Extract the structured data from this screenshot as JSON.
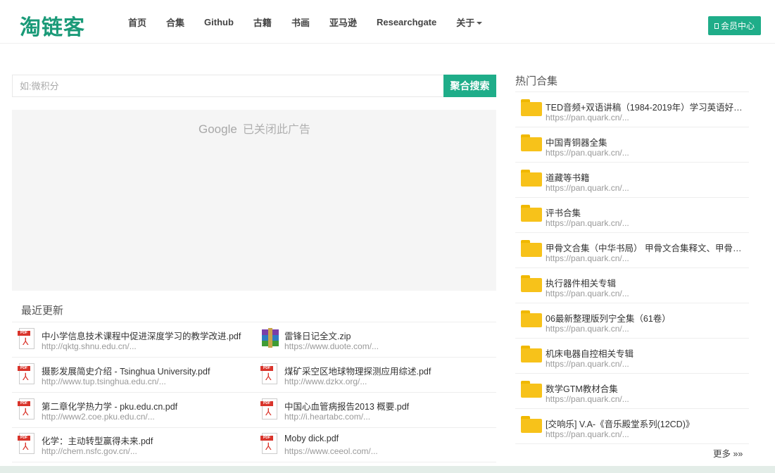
{
  "header": {
    "logo": "淘链客",
    "nav": [
      {
        "label": "首页"
      },
      {
        "label": "合集"
      },
      {
        "label": "Github"
      },
      {
        "label": "古籍"
      },
      {
        "label": "书画"
      },
      {
        "label": "亚马逊"
      },
      {
        "label": "Researchgate"
      },
      {
        "label": "关于"
      }
    ],
    "member_button": "会员中心"
  },
  "search": {
    "placeholder": "如:微积分",
    "button": "聚合搜索"
  },
  "ad": {
    "brand": "Google",
    "text": "已关闭此广告"
  },
  "recent": {
    "title": "最近更新",
    "items": [
      {
        "name": "中小学信息技术课程中促进深度学习的教学改进.pdf",
        "url": "http://qktg.shnu.edu.cn/...",
        "icon": "pdf-icon"
      },
      {
        "name": "雷锋日记全文.zip",
        "url": "https://www.duote.com/...",
        "icon": "zip-icon"
      },
      {
        "name": "摄影发展简史介绍 - Tsinghua University.pdf",
        "url": "http://www.tup.tsinghua.edu.cn/...",
        "icon": "pdf-icon"
      },
      {
        "name": "煤矿采空区地球物理探测应用综述.pdf",
        "url": "http://www.dzkx.org/...",
        "icon": "pdf-icon"
      },
      {
        "name": "第二章化学热力学 - pku.edu.cn.pdf",
        "url": "http://www2.coe.pku.edu.cn/...",
        "icon": "pdf-icon"
      },
      {
        "name": "中国心血管病报告2013 概要.pdf",
        "url": "http://i.heartabc.com/...",
        "icon": "pdf-icon"
      },
      {
        "name": "化学：主动转型赢得未来.pdf",
        "url": "http://chem.nsfc.gov.cn/...",
        "icon": "pdf-icon"
      },
      {
        "name": "Moby dick.pdf",
        "url": "https://www.ceeol.com/...",
        "icon": "pdf-icon"
      }
    ]
  },
  "hot": {
    "title": "热门合集",
    "items": [
      {
        "name": "TED音频+双语讲稿（1984-2019年）学习英语好资...",
        "url": "https://pan.quark.cn/..."
      },
      {
        "name": "中国青铜器全集",
        "url": "https://pan.quark.cn/..."
      },
      {
        "name": "道藏等书籍",
        "url": "https://pan.quark.cn/..."
      },
      {
        "name": "评书合集",
        "url": "https://pan.quark.cn/..."
      },
      {
        "name": "甲骨文合集（中华书局） 甲骨文合集释文、甲骨文...",
        "url": "https://pan.quark.cn/..."
      },
      {
        "name": "执行器件相关专辑",
        "url": "https://pan.quark.cn/..."
      },
      {
        "name": "06最新整理版列宁全集（61卷）",
        "url": "https://pan.quark.cn/..."
      },
      {
        "name": "机床电器自控相关专辑",
        "url": "https://pan.quark.cn/..."
      },
      {
        "name": "数学GTM教材合集",
        "url": "https://pan.quark.cn/..."
      },
      {
        "name": "[交响乐] V.A-《音乐殿堂系列(12CD)》",
        "url": "https://pan.quark.cn/..."
      }
    ],
    "more": "更多 »»"
  },
  "colors": {
    "brand": "#1a9a78",
    "button": "#1fad89",
    "folder": "#f7c21a",
    "pdf": "#d9342b"
  }
}
